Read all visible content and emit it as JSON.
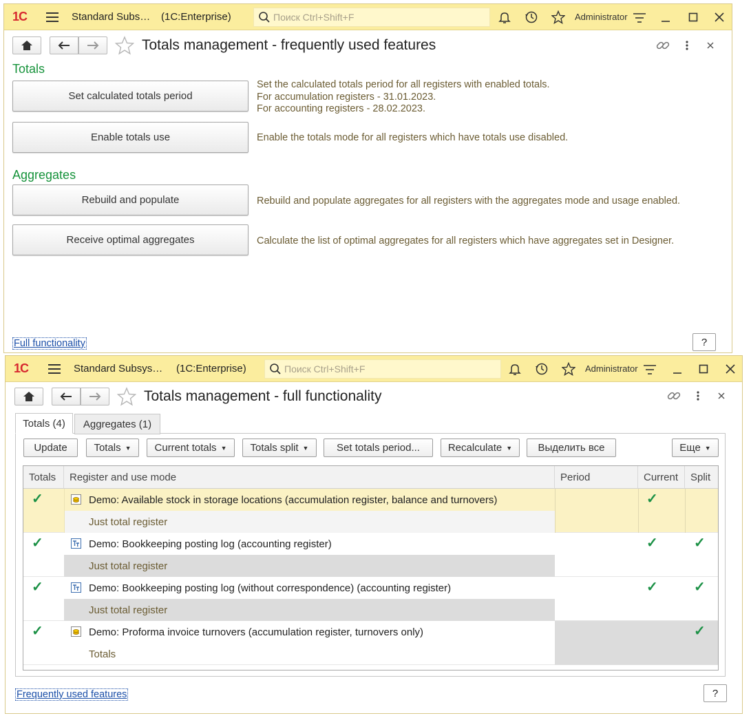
{
  "window1": {
    "app_title": "Standard Subs…",
    "platform": "(1C:Enterprise)",
    "search_placeholder": "Поиск Ctrl+Shift+F",
    "user": "Administrator",
    "form_title": "Totals management - frequently used features",
    "sections": {
      "totals": "Totals",
      "aggregates": "Aggregates"
    },
    "actions": [
      {
        "label": "Set calculated totals period",
        "desc": [
          "Set the calculated totals period for all registers with enabled totals.",
          "For accumulation registers - 31.01.2023.",
          "For accounting registers - 28.02.2023."
        ]
      },
      {
        "label": "Enable totals use",
        "desc": [
          "Enable the totals mode for all registers which have totals use disabled."
        ]
      },
      {
        "label": "Rebuild and populate",
        "desc": [
          "Rebuild and populate aggregates for all registers with the aggregates mode and usage enabled."
        ]
      },
      {
        "label": "Receive optimal aggregates",
        "desc": [
          "Calculate the list of optimal aggregates for all registers which have aggregates set in Designer."
        ]
      }
    ],
    "footer_link": "Full functionality",
    "help": "?"
  },
  "window2": {
    "app_title": "Standard Subsys…",
    "platform": "(1C:Enterprise)",
    "search_placeholder": "Поиск Ctrl+Shift+F",
    "user": "Administrator",
    "form_title": "Totals management - full functionality",
    "tabs": [
      "Totals (4)",
      "Aggregates (1)"
    ],
    "toolbar": [
      "Update",
      "Totals",
      "Current totals",
      "Totals split",
      "Set totals period...",
      "Recalculate",
      "Выделить все",
      "Еще"
    ],
    "columns": [
      "Totals",
      "Register and use mode",
      "Period",
      "Current",
      "Split"
    ],
    "rows": [
      {
        "name": "Demo: Available stock in storage locations (accumulation register, balance and turnovers)",
        "mode": "Just total register",
        "totals": true,
        "current": true,
        "split": false,
        "icon": "accumulation-register-icon"
      },
      {
        "name": "Demo: Bookkeeping posting log (accounting register)",
        "mode": "Just total register",
        "totals": true,
        "current": true,
        "split": true,
        "icon": "accounting-register-icon"
      },
      {
        "name": "Demo: Bookkeeping posting log (without correspondence) (accounting register)",
        "mode": "Just total register",
        "totals": true,
        "current": true,
        "split": true,
        "icon": "accounting-register-icon"
      },
      {
        "name": "Demo: Proforma invoice turnovers (accumulation register, turnovers only)",
        "mode": "Totals",
        "totals": true,
        "current": false,
        "split": true,
        "icon": "accumulation-register-icon"
      }
    ],
    "check_glyph": "✓",
    "footer_link": "Frequently used features",
    "help": "?"
  },
  "colors": {
    "titlebar": "#fbed9e",
    "section_green": "#16933b",
    "check_green": "#1c9146",
    "selected_row": "#fbf2c4",
    "desc_text": "#6b5c33"
  }
}
